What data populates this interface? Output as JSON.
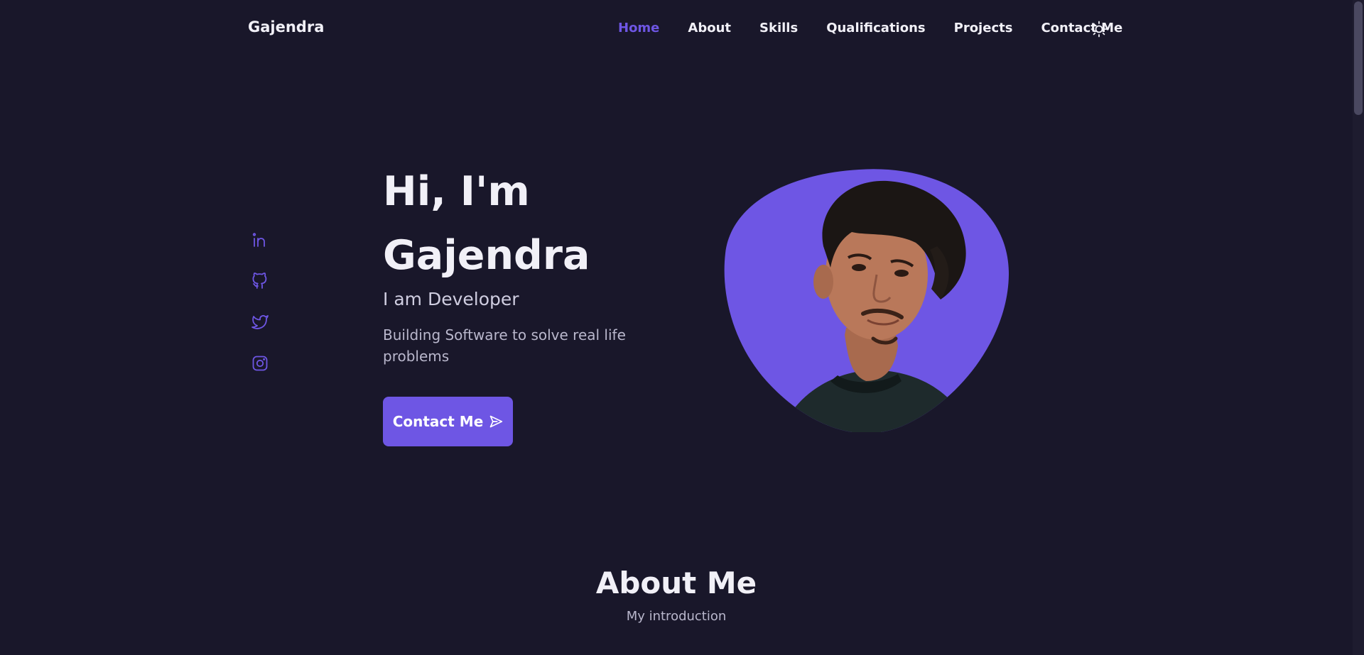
{
  "header": {
    "logo": "Gajendra",
    "nav": [
      {
        "label": "Home",
        "active": true
      },
      {
        "label": "About",
        "active": false
      },
      {
        "label": "Skills",
        "active": false
      },
      {
        "label": "Qualifications",
        "active": false
      },
      {
        "label": "Projects",
        "active": false
      },
      {
        "label": "Contact Me",
        "active": false
      }
    ],
    "theme_toggle_icon": "sun-icon"
  },
  "social": [
    {
      "icon": "linkedin-icon"
    },
    {
      "icon": "github-icon"
    },
    {
      "icon": "twitter-icon"
    },
    {
      "icon": "instagram-icon"
    }
  ],
  "hero": {
    "title_line1": "Hi, I'm",
    "title_line2": "Gajendra",
    "subtitle": "I am Developer",
    "description": "Building Software to solve real life problems",
    "button_label": "Contact Me",
    "button_icon": "send-icon"
  },
  "about": {
    "title": "About Me",
    "subtitle": "My introduction"
  },
  "colors": {
    "background": "#19172a",
    "accent": "#6e56e4",
    "text": "#f1f0f7",
    "muted": "#b9b7cc"
  }
}
